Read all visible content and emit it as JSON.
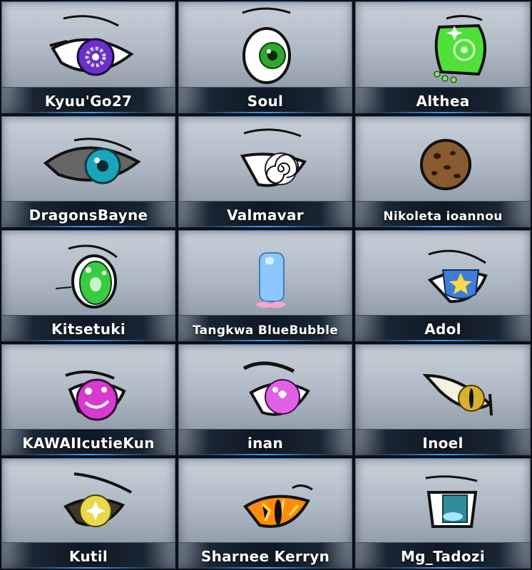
{
  "tiles": [
    {
      "name": "Kyuu'Go27",
      "icon": "purple-gear-eye-icon",
      "iris": "#6a2fc8"
    },
    {
      "name": "Soul",
      "icon": "green-round-eye-icon",
      "iris": "#2ea82e"
    },
    {
      "name": "Althea",
      "icon": "green-sparkle-eye-icon",
      "iris": "#4fe03a"
    },
    {
      "name": "DragonsBayne",
      "icon": "teal-eye-icon",
      "iris": "#1aa6b8"
    },
    {
      "name": "Valmavar",
      "icon": "spiral-eye-icon",
      "iris": "#ffffff"
    },
    {
      "name": "Nikoleta ioannou",
      "icon": "cookie-icon",
      "iris": "#8a5a30"
    },
    {
      "name": "Kitsetuki",
      "icon": "green-shiny-eye-icon",
      "iris": "#38cc44"
    },
    {
      "name": "Tangkwa BlueBubble",
      "icon": "blue-bubble-icon",
      "iris": "#8cc8ff"
    },
    {
      "name": "Adol",
      "icon": "star-eye-icon",
      "iris": "#3c7ed8"
    },
    {
      "name": "KAWAIIcutieKun",
      "icon": "pink-swirl-eye-icon",
      "iris": "#d83ad0"
    },
    {
      "name": "inan",
      "icon": "pink-sparkle-eye-icon",
      "iris": "#e060e6"
    },
    {
      "name": "Inoel",
      "icon": "cat-eye-icon",
      "iris": "#d8b030"
    },
    {
      "name": "Kutil",
      "icon": "yellow-star-eye-icon",
      "iris": "#e8d84a"
    },
    {
      "name": "Sharnee Kerryn",
      "icon": "orange-dragon-eye-icon",
      "iris": "#ff8a10"
    },
    {
      "name": "Mg_Tadozi",
      "icon": "teal-square-eye-icon",
      "iris": "#2f8d9a"
    }
  ]
}
